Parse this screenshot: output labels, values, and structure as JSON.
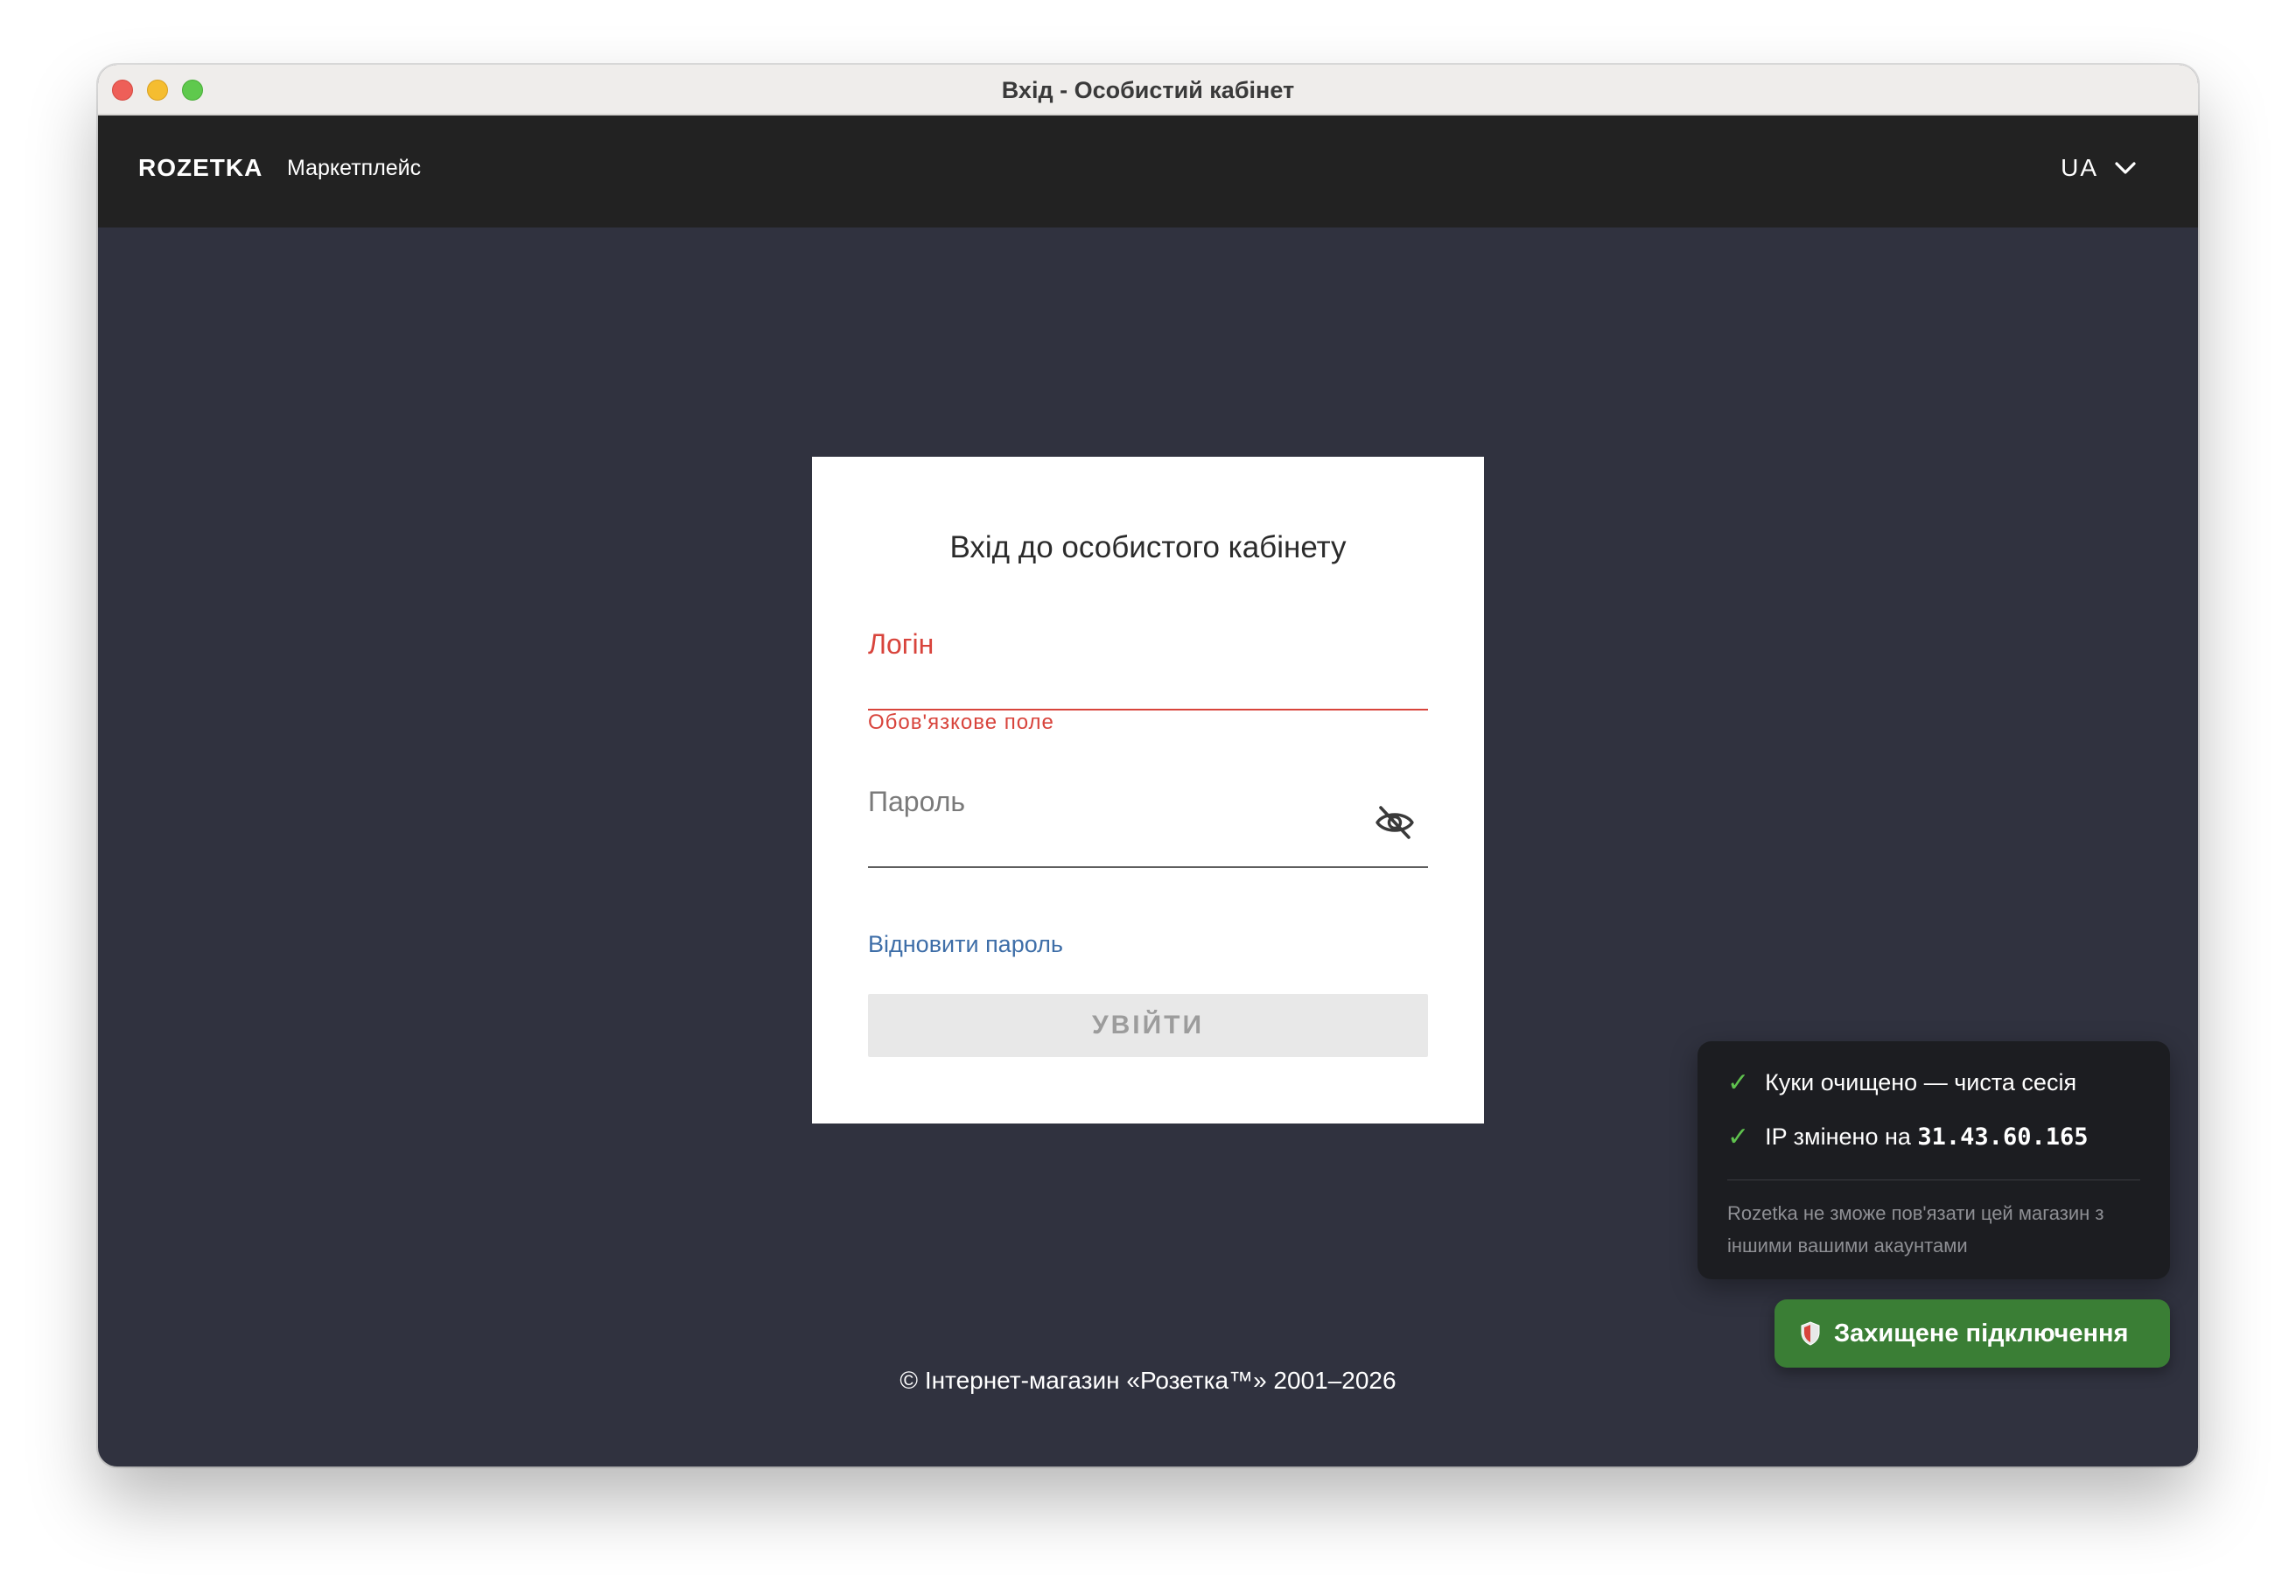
{
  "window": {
    "title": "Вхід - Особистий кабінет"
  },
  "header": {
    "logo": "ROZETKA",
    "logo_sub": "Маркетплейс",
    "language": "UA"
  },
  "login_card": {
    "title": "Вхід до особистого кабінету",
    "login_label": "Логін",
    "login_value": "",
    "login_error": "Обов'язкове поле",
    "password_label": "Пароль",
    "password_value": "",
    "restore_link": "Відновити пароль",
    "submit_label": "УВІЙТИ"
  },
  "footer": {
    "copyright": "© Інтернет-магазин «Розетка™» 2001–2026"
  },
  "popup": {
    "cookies_text": "Куки очищено — чиста сесія",
    "ip_prefix": "IP змінено на",
    "ip_value": "31.43.60.165",
    "note": "Rozetka не зможе пов'язати цей магазин з іншими вашими акаунтами"
  },
  "secure_button": {
    "label": "Захищене підключення"
  },
  "colors": {
    "page_bg": "#30323f",
    "header_bg": "#222222",
    "error": "#d8443c",
    "link": "#3e6ea8",
    "secure_green": "#3a7e35",
    "check_green": "#5fc24e"
  }
}
